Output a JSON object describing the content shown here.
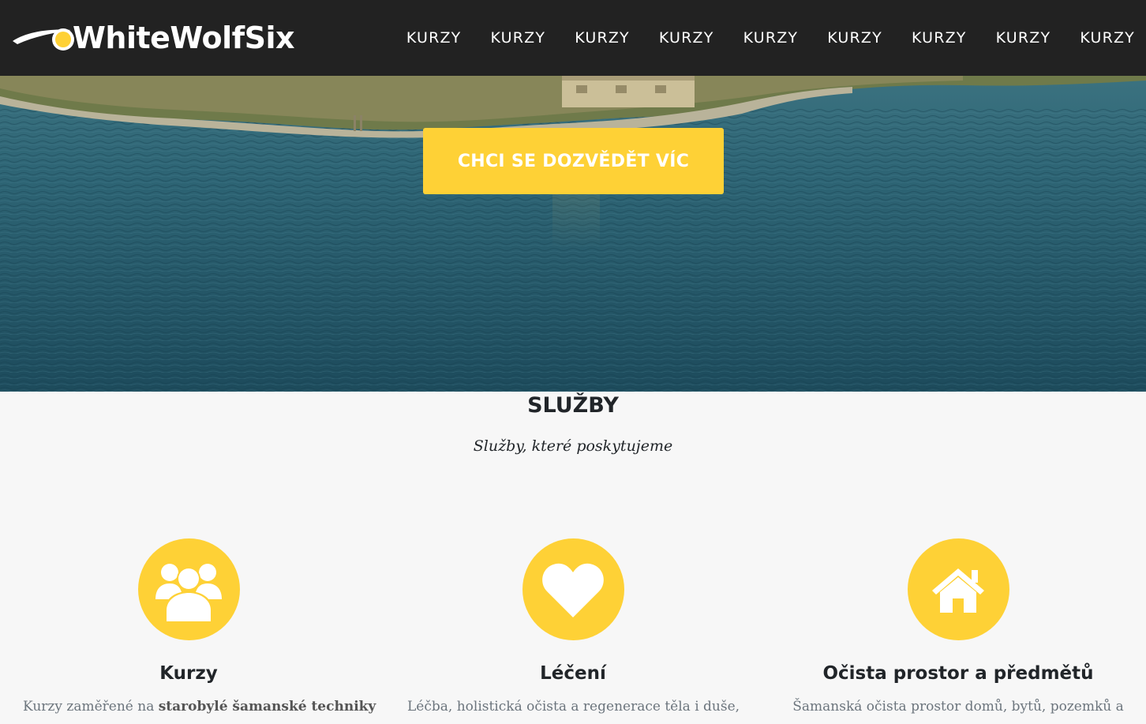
{
  "brand": {
    "name": "WhiteWolfSix",
    "accent_color": "#fed136",
    "nav_bg": "#222222"
  },
  "nav": {
    "items": [
      {
        "label": "KURZY"
      },
      {
        "label": "KURZY"
      },
      {
        "label": "KURZY"
      },
      {
        "label": "KURZY"
      },
      {
        "label": "KURZY"
      },
      {
        "label": "KURZY"
      },
      {
        "label": "KURZY"
      },
      {
        "label": "KURZY"
      },
      {
        "label": "KURZY"
      }
    ]
  },
  "hero": {
    "cta_label": "CHCI SE DOZVĚDĚT VÍC"
  },
  "services": {
    "heading": "SLUŽBY",
    "subheading": "Služby, které poskytujeme",
    "items": [
      {
        "icon": "users-icon",
        "title": "Kurzy",
        "text_prefix": "Kurzy zaměřené na ",
        "text_bold": "starobylé šamanské techniky"
      },
      {
        "icon": "heart-icon",
        "title": "Léčení",
        "text_prefix": "Léčba, holistická očista a regenerace těla i duše,",
        "text_bold": ""
      },
      {
        "icon": "home-icon",
        "title": "Očista prostor a předmětů",
        "text_prefix": "Šamanská očista prostor domů, bytů, pozemků a",
        "text_bold": ""
      }
    ]
  }
}
